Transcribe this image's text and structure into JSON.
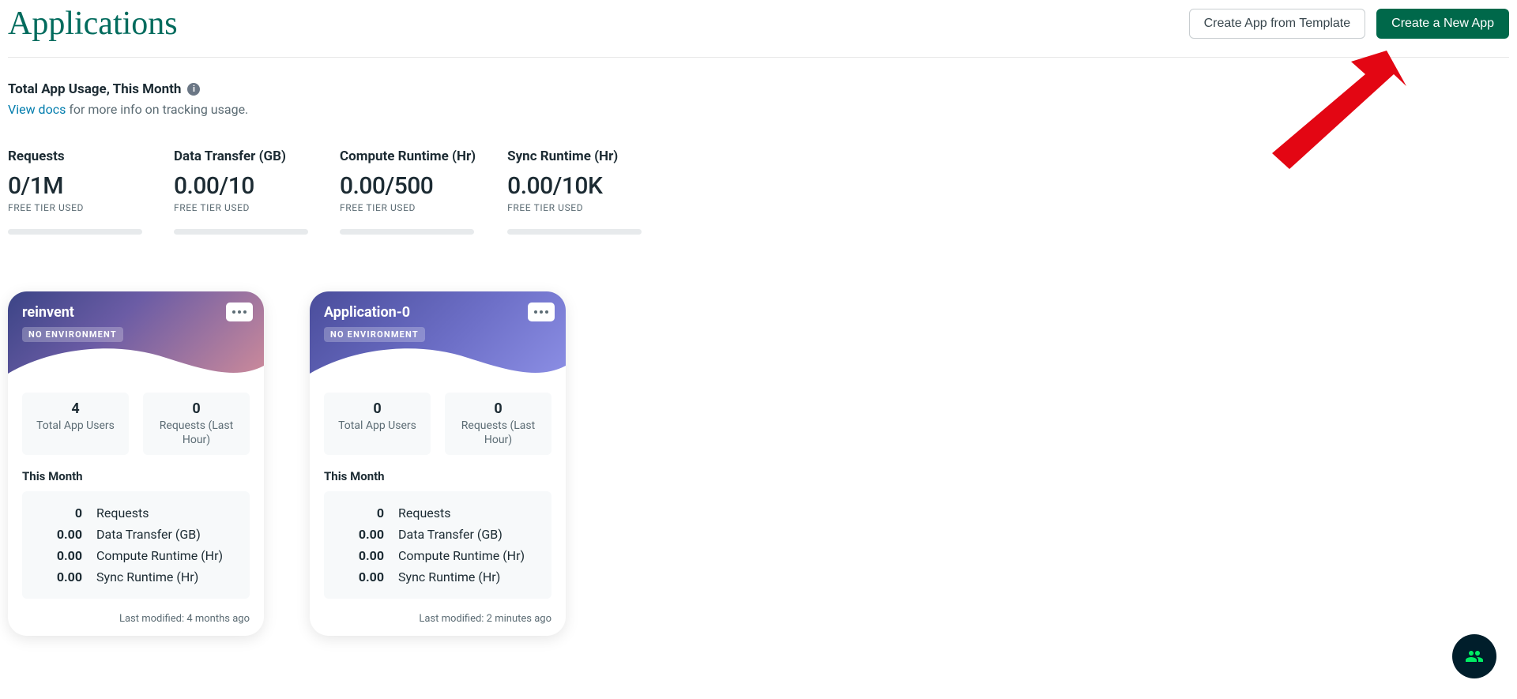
{
  "page_title": "Applications",
  "buttons": {
    "create_from_template": "Create App from Template",
    "create_new_app": "Create a New App"
  },
  "usage": {
    "heading": "Total App Usage, This Month",
    "docs_link": "View docs",
    "docs_suffix": " for more info on tracking usage."
  },
  "metrics": [
    {
      "title": "Requests",
      "value": "0/1M",
      "sub": "FREE TIER USED"
    },
    {
      "title": "Data Transfer (GB)",
      "value": "0.00/10",
      "sub": "FREE TIER USED"
    },
    {
      "title": "Compute Runtime (Hr)",
      "value": "0.00/500",
      "sub": "FREE TIER USED"
    },
    {
      "title": "Sync Runtime (Hr)",
      "value": "0.00/10K",
      "sub": "FREE TIER USED"
    }
  ],
  "apps": [
    {
      "name": "reinvent",
      "badge": "NO ENVIRONMENT",
      "gradient": "gradient-a",
      "users_value": "4",
      "users_label": "Total App Users",
      "requests_value": "0",
      "requests_label": "Requests (Last Hour)",
      "month_label": "This Month",
      "month_rows": [
        {
          "value": "0",
          "label": "Requests"
        },
        {
          "value": "0.00",
          "label": "Data Transfer (GB)"
        },
        {
          "value": "0.00",
          "label": "Compute Runtime (Hr)"
        },
        {
          "value": "0.00",
          "label": "Sync Runtime (Hr)"
        }
      ],
      "last_modified": "Last modified: 4 months ago"
    },
    {
      "name": "Application-0",
      "badge": "NO ENVIRONMENT",
      "gradient": "gradient-b",
      "users_value": "0",
      "users_label": "Total App Users",
      "requests_value": "0",
      "requests_label": "Requests (Last Hour)",
      "month_label": "This Month",
      "month_rows": [
        {
          "value": "0",
          "label": "Requests"
        },
        {
          "value": "0.00",
          "label": "Data Transfer (GB)"
        },
        {
          "value": "0.00",
          "label": "Compute Runtime (Hr)"
        },
        {
          "value": "0.00",
          "label": "Sync Runtime (Hr)"
        }
      ],
      "last_modified": "Last modified: 2 minutes ago"
    }
  ]
}
